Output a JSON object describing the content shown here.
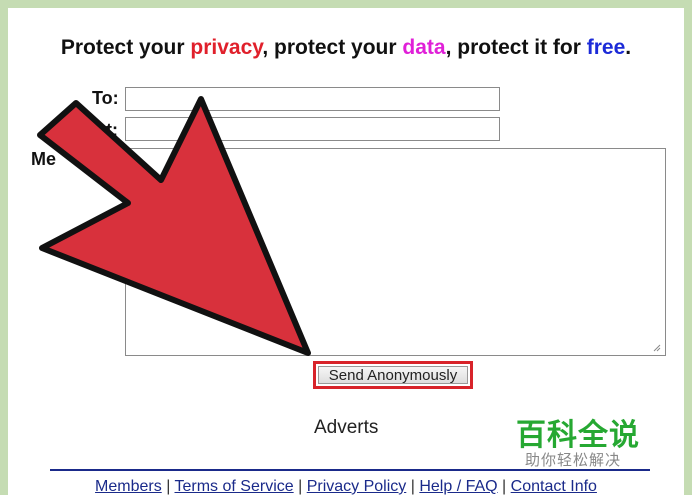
{
  "headline": {
    "p1": "Protect your ",
    "w1": "privacy",
    "p2": ", protect your ",
    "w2": "data",
    "p3": ", protect it for ",
    "w3": "free",
    "p4": "."
  },
  "form": {
    "to_label": "To:",
    "subject_label": "t:",
    "message_label": "Me",
    "to_value": "",
    "subject_value": "",
    "message_value": "",
    "send_label": "Send Anonymously"
  },
  "adverts_label": "Adverts",
  "footer": {
    "links": [
      "Members",
      "Terms of Service",
      "Privacy Policy",
      "Help / FAQ",
      "Contact Info"
    ],
    "separator": "|"
  },
  "watermark": {
    "title": "百科全说",
    "subtitle": "助你轻松解决"
  },
  "colors": {
    "accent_red": "#e0202b",
    "accent_magenta": "#e020d8",
    "accent_blue": "#1c2bd8",
    "arrow_red": "#d8313c",
    "button_highlight": "#d8232a",
    "link_blue": "#1a2a8a",
    "watermark_green": "#26a832",
    "frame_green": "#c5dcb3"
  },
  "icons": [
    "big-red-arrow-icon",
    "resize-grip-icon"
  ]
}
